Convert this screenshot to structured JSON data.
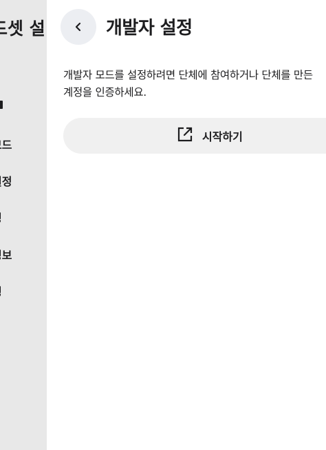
{
  "background_panel": {
    "title": "드셋 설",
    "items": [
      "모드",
      "설정",
      "정",
      "정보",
      "경"
    ]
  },
  "header": {
    "back_icon": "chevron-left-icon",
    "title": "개발자 설정"
  },
  "main": {
    "description": "개발자 모드를 설정하려면 단체에 참여하거나 단체를 만든 계정을 인증하세요.",
    "start_button": {
      "icon": "open-external-icon",
      "label": "시작하기"
    }
  },
  "colors": {
    "side_panel_bg": "#e8e8e8",
    "back_button_bg": "#eceef2",
    "start_button_bg": "#f0f0f0",
    "text": "#1d1d1f"
  }
}
